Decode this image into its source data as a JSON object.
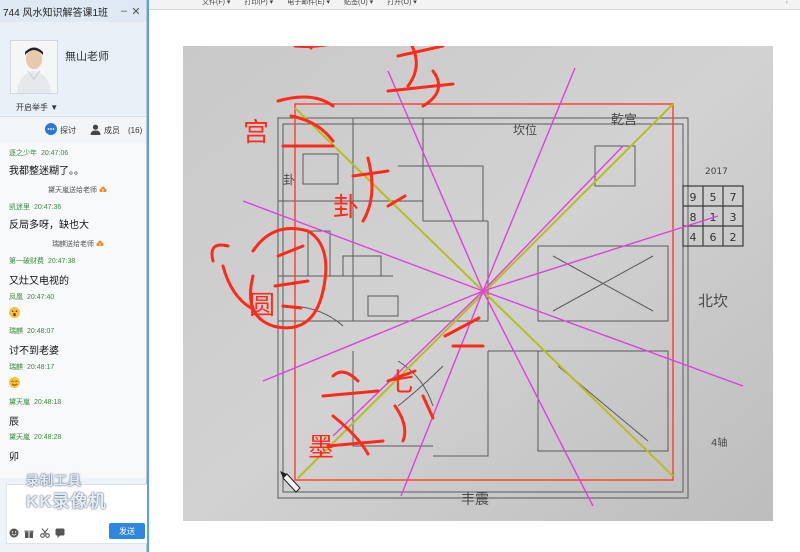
{
  "window": {
    "title": "744 风水知识解答课1班",
    "minimize_label": "–",
    "close_label": "✕"
  },
  "teacher": {
    "name": "無山老师",
    "hand_raise_label": "开启举手 ▼"
  },
  "tabs": {
    "discuss_label": "探讨",
    "members_label": "成员",
    "members_count": "(16)"
  },
  "messages": [
    {
      "user": "逐之少年",
      "time": "20:47:06",
      "text": "我都整迷糊了。。"
    },
    {
      "system": "黛天嵐送给老师"
    },
    {
      "user": "凯迷里",
      "time": "20:47:36",
      "text": "反局多呀，缺也大"
    },
    {
      "system": "瑞麒送给老师"
    },
    {
      "user": "第一破财费",
      "time": "20:47:38",
      "text": "又灶又电视的"
    },
    {
      "user": "凤凰",
      "time": "20:47:40",
      "emoji": "surprised-emoji"
    },
    {
      "user": "瑞麒",
      "time": "20:48:07",
      "text": "讨不到老婆"
    },
    {
      "user": "瑞麒",
      "time": "20:48:17",
      "emoji": "smile-emoji"
    },
    {
      "user": "黛天嵐",
      "time": "20:48:18",
      "text": "辰"
    },
    {
      "user": "黛天嵐",
      "time": "20:48:28",
      "text": "卯"
    }
  ],
  "watermark": {
    "line1": "录制工具",
    "line2": "KK录像机"
  },
  "input": {
    "send_label": "发送"
  },
  "viewer": {
    "menu": [
      "文件(F) ▾",
      "打印(P) ▾",
      "电子邮件(E) ▾",
      "贴签(U) ▾",
      "打开(O) ▾"
    ],
    "menu_grip": "⁝"
  },
  "drawing": {
    "luoshu_grid": [
      "9",
      "5",
      "7",
      "8",
      "1",
      "3",
      "4",
      "6",
      "2"
    ],
    "luoshu_header": "2017",
    "pencil_labels": [
      "乾宫",
      "坎位",
      "北坎",
      "卦",
      "丰震",
      "4轴"
    ],
    "red_annotations": [
      "兵",
      "宫",
      "卦",
      "圆",
      "墨",
      "七"
    ],
    "colors": {
      "pink_lines": "#e040e0",
      "olive_lines": "#b6bf1e",
      "red_frame": "#ff3b2f",
      "red_ink": "#ff2a1a",
      "paper": "#c8c8c8"
    }
  }
}
